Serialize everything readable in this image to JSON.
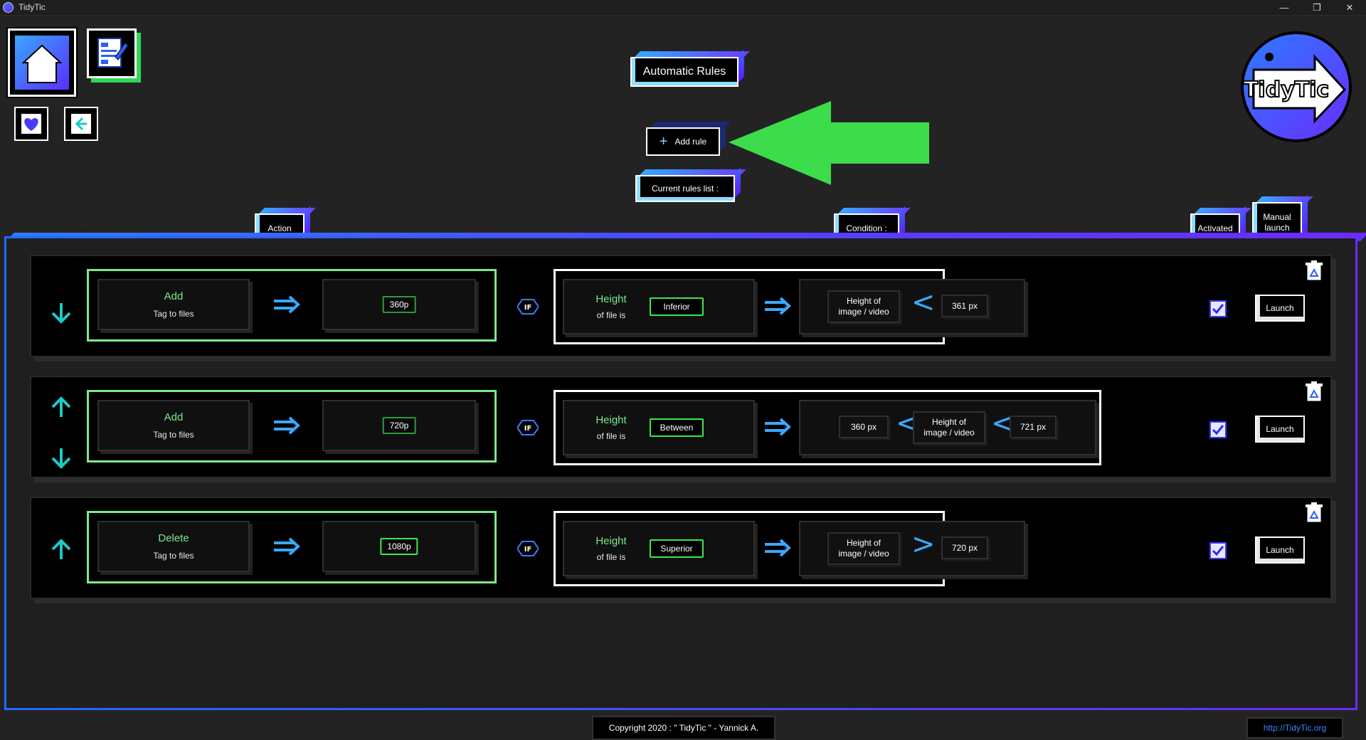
{
  "window": {
    "title": "TidyTic",
    "min": "—",
    "max": "❐",
    "close": "✕"
  },
  "header": {
    "title": "Automatic Rules",
    "add_rule": "Add rule",
    "current_list": "Current rules list :"
  },
  "logo_text": "TidyTic",
  "columns": {
    "action": "Action",
    "condition": "Condition :",
    "activated": "Activated",
    "manual_line1": "Manual",
    "manual_line2": "launch"
  },
  "rules": [
    {
      "verb": "Add",
      "object": "Tag to files",
      "value": "360p",
      "if_label": "IF",
      "cond_line1": "Height",
      "cond_line2": "of file is",
      "operator": "Inferior",
      "target_line1": "Height of",
      "target_line2": "image / video",
      "symbol": "<",
      "limit": "361 px",
      "activated": true,
      "launch": "Launch",
      "up": false,
      "down": true
    },
    {
      "verb": "Add",
      "object": "Tag to files",
      "value": "720p",
      "if_label": "IF",
      "cond_line1": "Height",
      "cond_line2": "of file is",
      "operator": "Between",
      "lower": "360 px",
      "symbol_a": "<",
      "target_line1": "Height of",
      "target_line2": "image / video",
      "symbol_b": "<",
      "upper": "721 px",
      "activated": true,
      "launch": "Launch",
      "up": true,
      "down": true
    },
    {
      "verb": "Delete",
      "object": "Tag to files",
      "value": "1080p",
      "if_label": "IF",
      "cond_line1": "Height",
      "cond_line2": "of file is",
      "operator": "Superior",
      "target_line1": "Height of",
      "target_line2": "image / video",
      "symbol": ">",
      "limit": "720 px",
      "activated": true,
      "launch": "Launch",
      "up": true,
      "down": false
    }
  ],
  "footer": {
    "copyright": "Copyright 2020 : \" TidyTic \" - Yannick A.",
    "link": "http://TidyTic.org"
  },
  "colors": {
    "accent_green": "#7de88a",
    "tag_green": "#39e84e",
    "brand_blue": "#2b7dff",
    "brand_purple": "#6a2cff",
    "arrow_blue": "#3aa8ff",
    "big_arrow": "#3ddc4a"
  },
  "icons": [
    "home-icon",
    "edit-icon",
    "heart-icon",
    "back-arrow-icon",
    "plus-icon",
    "arrow-down-icon",
    "arrow-up-icon",
    "double-arrow-right-icon",
    "if-icon",
    "checkbox-icon",
    "trash-icon"
  ]
}
